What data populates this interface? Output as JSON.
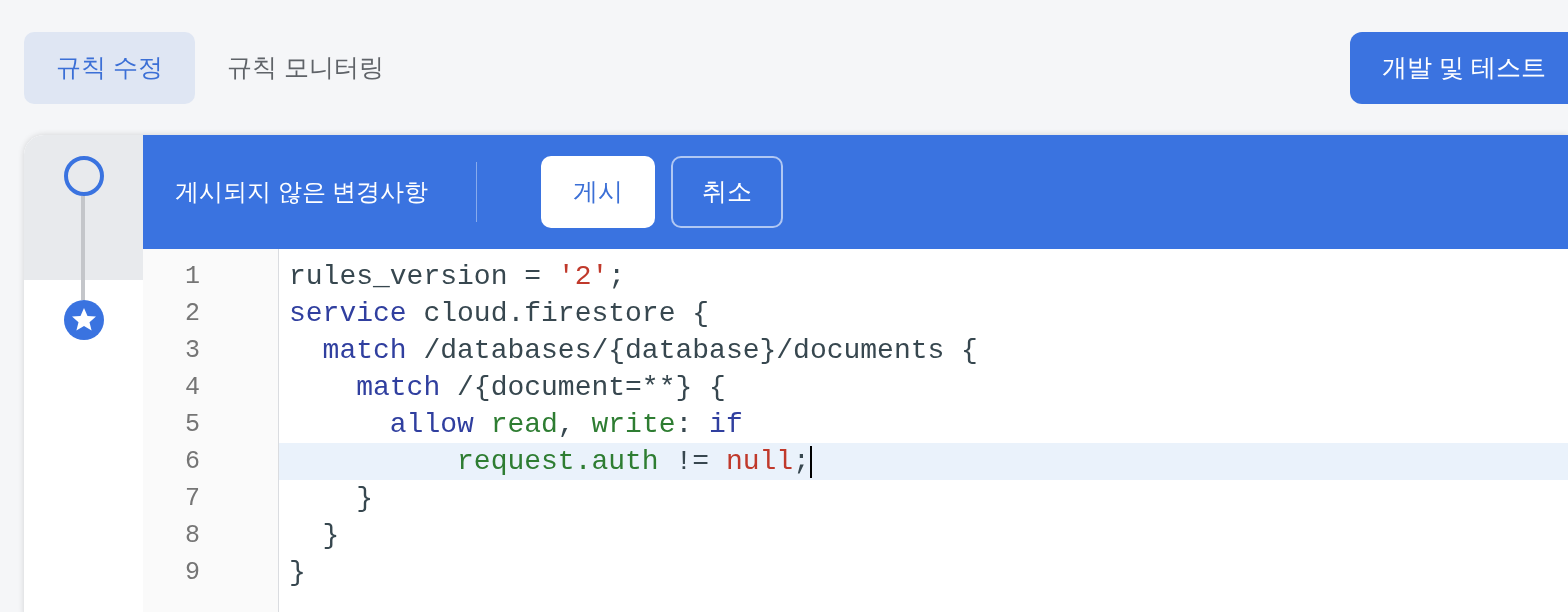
{
  "tabs": [
    {
      "label": "규칙 수정",
      "selected": true
    },
    {
      "label": "규칙 모니터링",
      "selected": false
    }
  ],
  "action_button": "개발 및 테스트",
  "timeline": [
    {
      "kind": "draft",
      "selected": true
    },
    {
      "kind": "published",
      "selected": false
    }
  ],
  "toolbar": {
    "status": "게시되지 않은 변경사항",
    "buttons": [
      {
        "label": "게시",
        "kind": "primary"
      },
      {
        "label": "취소",
        "kind": "outline"
      }
    ]
  },
  "editor": {
    "lines": [
      {
        "number": "1",
        "current": false,
        "tokens": [
          {
            "kind": "plain",
            "text": "rules_version = "
          },
          {
            "kind": "literal",
            "text": "'2'"
          },
          {
            "kind": "plain",
            "text": ";"
          }
        ]
      },
      {
        "number": "2",
        "current": false,
        "tokens": [
          {
            "kind": "keyword",
            "text": "service"
          },
          {
            "kind": "plain",
            "text": " cloud.firestore {"
          }
        ]
      },
      {
        "number": "3",
        "current": false,
        "tokens": [
          {
            "kind": "keyword",
            "text": "  match"
          },
          {
            "kind": "plain",
            "text": " /databases/{database}/documents {"
          }
        ]
      },
      {
        "number": "4",
        "current": false,
        "tokens": [
          {
            "kind": "keyword",
            "text": "    match"
          },
          {
            "kind": "plain",
            "text": " /{document=**} {"
          }
        ]
      },
      {
        "number": "5",
        "current": false,
        "tokens": [
          {
            "kind": "keyword",
            "text": "      allow "
          },
          {
            "kind": "ident",
            "text": "read"
          },
          {
            "kind": "plain",
            "text": ", "
          },
          {
            "kind": "ident",
            "text": "write"
          },
          {
            "kind": "plain",
            "text": ": "
          },
          {
            "kind": "keyword",
            "text": "if"
          }
        ]
      },
      {
        "number": "6",
        "current": true,
        "tokens": [
          {
            "kind": "ident",
            "text": "          request.auth"
          },
          {
            "kind": "plain",
            "text": " != "
          },
          {
            "kind": "literal",
            "text": "null"
          },
          {
            "kind": "plain",
            "text": ";"
          }
        ]
      },
      {
        "number": "7",
        "current": false,
        "tokens": [
          {
            "kind": "plain",
            "text": "    }"
          }
        ]
      },
      {
        "number": "8",
        "current": false,
        "tokens": [
          {
            "kind": "plain",
            "text": "  }"
          }
        ]
      },
      {
        "number": "9",
        "current": false,
        "tokens": [
          {
            "kind": "plain",
            "text": "}"
          }
        ]
      }
    ]
  }
}
